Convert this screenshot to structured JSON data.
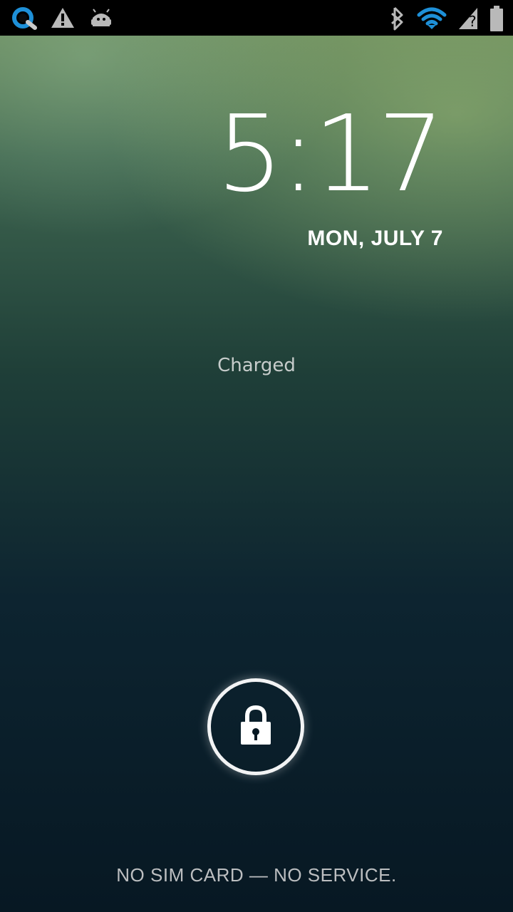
{
  "status_bar": {
    "left_icons": [
      "browser-q-icon",
      "warning-triangle-icon",
      "android-robot-icon"
    ],
    "right_icons": [
      "bluetooth-icon",
      "wifi-icon",
      "unknown-signal-icon",
      "battery-icon"
    ]
  },
  "lockscreen": {
    "time": "5:17",
    "date": "MON, JULY 7",
    "charging_status": "Charged",
    "carrier_status": "NO SIM CARD — NO SERVICE."
  },
  "colors": {
    "accent_blue": "#1e90d8",
    "status_icon_gray": "#b9b9b9",
    "text_white": "#ffffff"
  }
}
